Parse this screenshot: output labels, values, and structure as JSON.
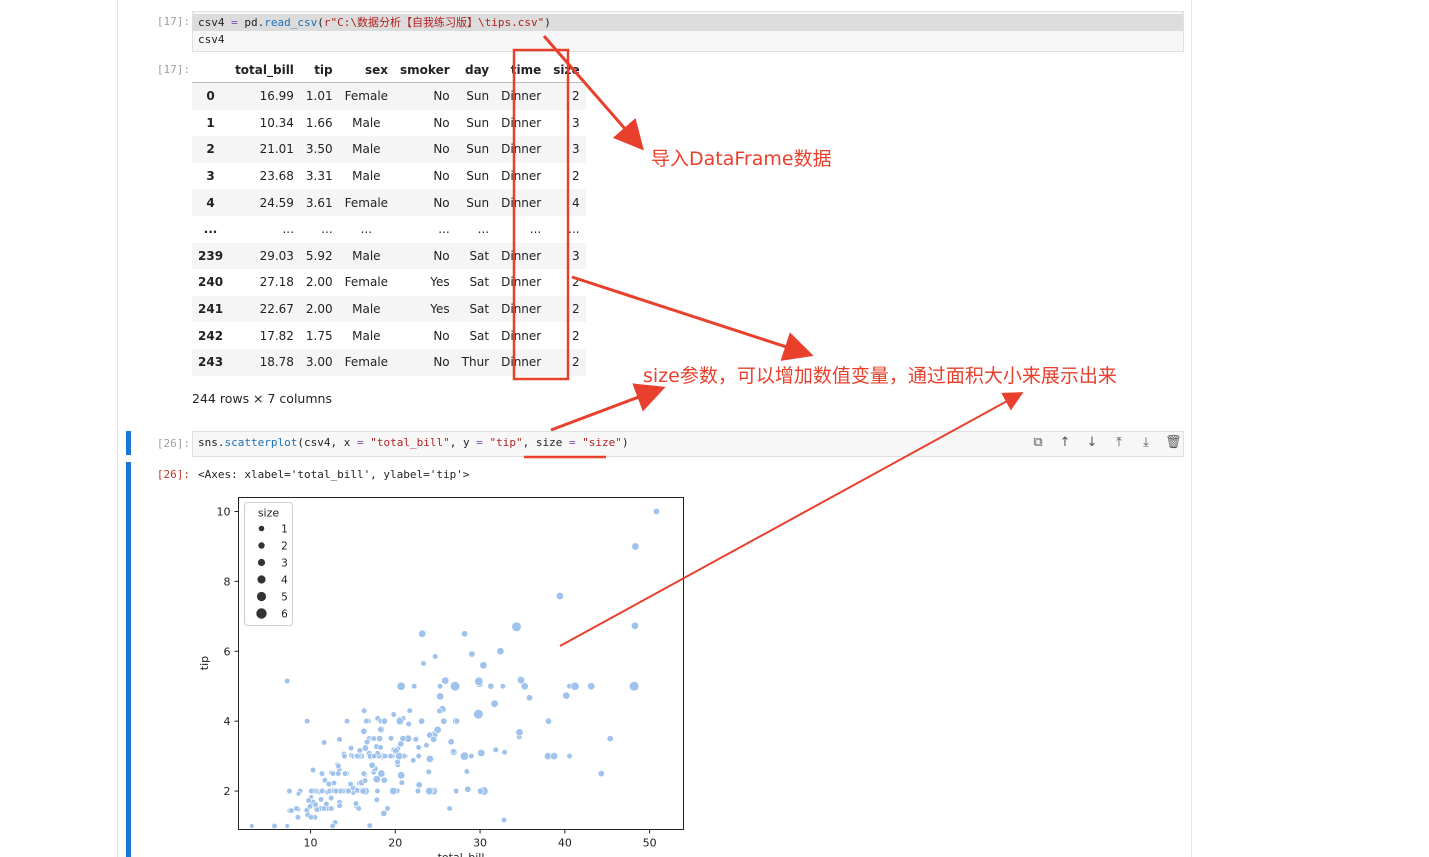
{
  "cell17": {
    "in_prompt": "[17]:",
    "out_prompt": "[17]:",
    "code_lines": [
      [
        [
          "csv4 ",
          "var"
        ],
        [
          "=",
          "op"
        ],
        [
          " pd.",
          "var"
        ],
        [
          "read_csv",
          "fn"
        ],
        [
          "(",
          "var"
        ],
        [
          "r\"C:\\数据分析【自我练习版】\\tips.csv\"",
          "str"
        ],
        [
          ")",
          "var"
        ]
      ],
      [
        [
          "csv4",
          "var"
        ]
      ]
    ]
  },
  "dataframe": {
    "columns": [
      "",
      "total_bill",
      "tip",
      "sex",
      "smoker",
      "day",
      "time",
      "size"
    ],
    "rows": [
      [
        "0",
        "16.99",
        "1.01",
        "Female",
        "No",
        "Sun",
        "Dinner",
        "2"
      ],
      [
        "1",
        "10.34",
        "1.66",
        "Male",
        "No",
        "Sun",
        "Dinner",
        "3"
      ],
      [
        "2",
        "21.01",
        "3.50",
        "Male",
        "No",
        "Sun",
        "Dinner",
        "3"
      ],
      [
        "3",
        "23.68",
        "3.31",
        "Male",
        "No",
        "Sun",
        "Dinner",
        "2"
      ],
      [
        "4",
        "24.59",
        "3.61",
        "Female",
        "No",
        "Sun",
        "Dinner",
        "4"
      ],
      [
        "...",
        "...",
        "...",
        "...",
        "...",
        "...",
        "...",
        "..."
      ],
      [
        "239",
        "29.03",
        "5.92",
        "Male",
        "No",
        "Sat",
        "Dinner",
        "3"
      ],
      [
        "240",
        "27.18",
        "2.00",
        "Female",
        "Yes",
        "Sat",
        "Dinner",
        "2"
      ],
      [
        "241",
        "22.67",
        "2.00",
        "Male",
        "Yes",
        "Sat",
        "Dinner",
        "2"
      ],
      [
        "242",
        "17.82",
        "1.75",
        "Male",
        "No",
        "Sat",
        "Dinner",
        "2"
      ],
      [
        "243",
        "18.78",
        "3.00",
        "Female",
        "No",
        "Thur",
        "Dinner",
        "2"
      ]
    ],
    "shape_text": "244 rows × 7 columns"
  },
  "cell26": {
    "in_prompt": "[26]:",
    "out_prompt": "[26]:",
    "code_tokens": [
      [
        "sns.",
        "var"
      ],
      [
        "scatterplot",
        "fn"
      ],
      [
        "(csv4, x ",
        "var"
      ],
      [
        "=",
        "op"
      ],
      [
        " ",
        "var"
      ],
      [
        "\"total_bill\"",
        "str"
      ],
      [
        ", y ",
        "var"
      ],
      [
        "=",
        "op"
      ],
      [
        " ",
        "var"
      ],
      [
        "\"tip\"",
        "str"
      ],
      [
        ", size ",
        "var"
      ],
      [
        "=",
        "op"
      ],
      [
        " ",
        "var"
      ],
      [
        "\"size\"",
        "str"
      ],
      [
        ")",
        "var"
      ]
    ],
    "output_text": "<Axes: xlabel='total_bill', ylabel='tip'>",
    "toolbar_icons": [
      "copy-icon",
      "arrow-up-icon",
      "arrow-down-icon",
      "insert-above-icon",
      "insert-below-icon",
      "trash-icon"
    ]
  },
  "annotations": {
    "import_label": "导入DataFrame数据",
    "size_label": "size参数，可以增加数值变量，通过面积大小来展示出来",
    "color": "#e8402d"
  },
  "chart_data": {
    "type": "scatter",
    "xlabel": "total_bill",
    "ylabel": "tip",
    "xticks": [
      10,
      20,
      30,
      40,
      50
    ],
    "yticks": [
      2,
      4,
      6,
      8,
      10
    ],
    "xlim": [
      1.5,
      54
    ],
    "ylim": [
      0.9,
      10.4
    ],
    "marker_color": "#9fc3ec",
    "legend": {
      "title": "size",
      "entries": [
        "1",
        "2",
        "3",
        "4",
        "5",
        "6"
      ],
      "placement": "top-left"
    },
    "points": [
      [
        50.81,
        10,
        3
      ],
      [
        48.33,
        9,
        4
      ],
      [
        39.42,
        7.58,
        4
      ],
      [
        48.27,
        6.73,
        4
      ],
      [
        34.3,
        6.7,
        6
      ],
      [
        23.33,
        6.5,
        2
      ],
      [
        28.2,
        6.5,
        2
      ],
      [
        7.25,
        5.15,
        2
      ],
      [
        20.69,
        5,
        5
      ],
      [
        24.71,
        5.85,
        2
      ],
      [
        32.4,
        6,
        4
      ],
      [
        29.03,
        5.92,
        3
      ],
      [
        30.4,
        5.6,
        4
      ],
      [
        25.89,
        5.16,
        4
      ],
      [
        43.11,
        5,
        4
      ],
      [
        48.17,
        5,
        6
      ],
      [
        40.55,
        5,
        2
      ],
      [
        44.3,
        2.5,
        3
      ],
      [
        34.81,
        5.2,
        4
      ],
      [
        30.14,
        3.09,
        4
      ],
      [
        27.18,
        2,
        2
      ],
      [
        26.88,
        3.12,
        4
      ],
      [
        16.99,
        1.01,
        2
      ],
      [
        10.34,
        1.66,
        3
      ],
      [
        21.01,
        3.5,
        3
      ],
      [
        23.68,
        3.31,
        2
      ],
      [
        24.59,
        3.61,
        4
      ],
      [
        25.29,
        4.71,
        4
      ],
      [
        8.77,
        2,
        2
      ],
      [
        26.88,
        3.12,
        4
      ],
      [
        15.04,
        1.96,
        2
      ],
      [
        14.78,
        3.23,
        2
      ],
      [
        10.27,
        1.71,
        2
      ],
      [
        35.26,
        5,
        4
      ],
      [
        15.42,
        1.57,
        2
      ],
      [
        18.43,
        3,
        4
      ],
      [
        14.83,
        3.02,
        2
      ],
      [
        21.58,
        3.92,
        2
      ],
      [
        10.33,
        1.67,
        3
      ],
      [
        16.29,
        3.71,
        3
      ],
      [
        16.97,
        3.5,
        3
      ],
      [
        20.65,
        3.35,
        3
      ],
      [
        17.92,
        4.08,
        2
      ],
      [
        20.29,
        2.75,
        2
      ],
      [
        15.77,
        2.23,
        2
      ],
      [
        39.42,
        7.58,
        4
      ],
      [
        19.82,
        3.18,
        2
      ],
      [
        17.81,
        2.34,
        4
      ],
      [
        13.37,
        2,
        2
      ],
      [
        12.69,
        2,
        2
      ],
      [
        21.7,
        4.3,
        2
      ],
      [
        19.65,
        3,
        2
      ],
      [
        9.55,
        1.45,
        2
      ],
      [
        18.35,
        2.5,
        4
      ],
      [
        15.06,
        3,
        2
      ],
      [
        20.69,
        2.45,
        4
      ],
      [
        17.78,
        3.27,
        2
      ],
      [
        24.06,
        3.6,
        3
      ],
      [
        16.31,
        2,
        3
      ],
      [
        16.93,
        3.07,
        3
      ],
      [
        18.69,
        2.31,
        3
      ],
      [
        31.27,
        5,
        3
      ],
      [
        16.04,
        2.24,
        3
      ],
      [
        17.46,
        2.54,
        2
      ],
      [
        13.94,
        3.06,
        2
      ],
      [
        9.68,
        1.32,
        2
      ],
      [
        30.4,
        5.6,
        4
      ],
      [
        18.29,
        3,
        2
      ],
      [
        22.23,
        5,
        2
      ],
      [
        32.4,
        6,
        4
      ],
      [
        28.55,
        2.05,
        3
      ],
      [
        18.04,
        3,
        2
      ],
      [
        12.54,
        2.5,
        2
      ],
      [
        10.29,
        2.6,
        2
      ],
      [
        34.81,
        5.2,
        4
      ],
      [
        9.94,
        1.56,
        2
      ],
      [
        25.56,
        4.34,
        4
      ],
      [
        19.49,
        3.51,
        2
      ],
      [
        38.01,
        3,
        4
      ],
      [
        26.41,
        1.5,
        2
      ],
      [
        11.24,
        1.76,
        2
      ],
      [
        48.27,
        6.73,
        4
      ],
      [
        20.29,
        3.21,
        2
      ],
      [
        13.81,
        2,
        2
      ],
      [
        11.02,
        1.98,
        2
      ],
      [
        18.29,
        3.76,
        4
      ],
      [
        17.59,
        2.64,
        3
      ],
      [
        20.08,
        3.15,
        3
      ],
      [
        16.45,
        2.47,
        2
      ],
      [
        3.07,
        1,
        1
      ],
      [
        20.23,
        2.01,
        2
      ],
      [
        15.01,
        2.09,
        2
      ],
      [
        12.02,
        1.97,
        2
      ],
      [
        17.07,
        3,
        3
      ],
      [
        26.86,
        3.14,
        2
      ],
      [
        25.28,
        5,
        2
      ],
      [
        14.73,
        2.2,
        2
      ],
      [
        10.51,
        1.25,
        2
      ],
      [
        17.92,
        3.08,
        2
      ],
      [
        27.2,
        4,
        4
      ],
      [
        22.76,
        3,
        2
      ],
      [
        17.29,
        2.71,
        2
      ],
      [
        19.44,
        3,
        2
      ],
      [
        16.66,
        3.4,
        2
      ],
      [
        10.07,
        1.83,
        1
      ],
      [
        32.68,
        5,
        2
      ],
      [
        15.98,
        2.03,
        2
      ],
      [
        34.83,
        5.17,
        4
      ],
      [
        13.03,
        2,
        2
      ],
      [
        18.28,
        4,
        2
      ],
      [
        24.71,
        5.85,
        2
      ],
      [
        21.16,
        3,
        2
      ],
      [
        28.97,
        3,
        2
      ],
      [
        22.49,
        3.5,
        2
      ],
      [
        5.75,
        1,
        2
      ],
      [
        16.32,
        4.3,
        2
      ],
      [
        22.75,
        3.25,
        2
      ],
      [
        40.17,
        4.73,
        4
      ],
      [
        27.28,
        4,
        2
      ],
      [
        12.03,
        1.5,
        2
      ],
      [
        21.01,
        3,
        2
      ],
      [
        12.46,
        1.5,
        2
      ],
      [
        11.35,
        2.5,
        2
      ],
      [
        15.38,
        3,
        2
      ],
      [
        44.3,
        2.5,
        3
      ],
      [
        22.42,
        3.48,
        2
      ],
      [
        20.92,
        4.08,
        2
      ],
      [
        15.36,
        1.64,
        2
      ],
      [
        20.49,
        4.06,
        2
      ],
      [
        25.21,
        4.29,
        2
      ],
      [
        18.24,
        3.76,
        2
      ],
      [
        14.31,
        4,
        2
      ],
      [
        14,
        3,
        2
      ],
      [
        7.25,
        1,
        1
      ],
      [
        38.07,
        4,
        3
      ],
      [
        23.95,
        2.55,
        2
      ],
      [
        25.71,
        4,
        3
      ],
      [
        17.31,
        3.5,
        2
      ],
      [
        29.93,
        5.07,
        4
      ],
      [
        10.65,
        1.5,
        2
      ],
      [
        12.43,
        1.8,
        2
      ],
      [
        24.08,
        2.92,
        4
      ],
      [
        11.69,
        2.31,
        2
      ],
      [
        13.42,
        1.68,
        2
      ],
      [
        14.26,
        2.5,
        2
      ],
      [
        15.95,
        2,
        2
      ],
      [
        12.48,
        2.52,
        2
      ],
      [
        29.8,
        4.2,
        6
      ],
      [
        8.52,
        1.48,
        2
      ],
      [
        14.52,
        2,
        2
      ],
      [
        11.38,
        2,
        2
      ],
      [
        22.82,
        2.18,
        3
      ],
      [
        19.08,
        1.5,
        2
      ],
      [
        20.27,
        2.83,
        2
      ],
      [
        11.17,
        1.5,
        2
      ],
      [
        12.26,
        2,
        2
      ],
      [
        18.26,
        3.25,
        2
      ],
      [
        8.51,
        1.25,
        2
      ],
      [
        10.33,
        2,
        2
      ],
      [
        14.15,
        2,
        2
      ],
      [
        16,
        2,
        2
      ],
      [
        13.16,
        2.75,
        2
      ],
      [
        17.47,
        3.5,
        2
      ],
      [
        34.3,
        6.7,
        6
      ],
      [
        41.19,
        5,
        5
      ],
      [
        27.05,
        5,
        6
      ],
      [
        16.43,
        2.3,
        2
      ],
      [
        8.35,
        1.5,
        2
      ],
      [
        18.64,
        1.36,
        3
      ],
      [
        11.87,
        1.63,
        2
      ],
      [
        9.78,
        1.73,
        2
      ],
      [
        7.51,
        2,
        2
      ],
      [
        14.07,
        2.5,
        2
      ],
      [
        13.13,
        2,
        2
      ],
      [
        17.26,
        2.74,
        3
      ],
      [
        24.55,
        2,
        4
      ],
      [
        19.77,
        2,
        4
      ],
      [
        29.85,
        5.14,
        5
      ],
      [
        48.17,
        5,
        6
      ],
      [
        25,
        3.75,
        4
      ],
      [
        13.39,
        2.61,
        2
      ],
      [
        16.49,
        2,
        4
      ],
      [
        21.5,
        3.5,
        4
      ],
      [
        12.66,
        2.5,
        2
      ],
      [
        16.21,
        2,
        3
      ],
      [
        13.81,
        2,
        2
      ],
      [
        17.51,
        3,
        2
      ],
      [
        24.52,
        3.48,
        3
      ],
      [
        20.76,
        2.24,
        2
      ],
      [
        31.71,
        4.5,
        4
      ],
      [
        10.59,
        1.61,
        2
      ],
      [
        10.63,
        2,
        2
      ],
      [
        50.81,
        10,
        3
      ],
      [
        15.81,
        3.16,
        2
      ],
      [
        7.25,
        5.15,
        2
      ],
      [
        31.85,
        3.18,
        2
      ],
      [
        16.82,
        4,
        2
      ],
      [
        32.9,
        3.11,
        2
      ],
      [
        17.89,
        2,
        2
      ],
      [
        14.48,
        2,
        2
      ],
      [
        9.6,
        4,
        2
      ],
      [
        34.63,
        3.55,
        2
      ],
      [
        34.65,
        3.68,
        4
      ],
      [
        23.33,
        5.65,
        2
      ],
      [
        45.35,
        3.5,
        3
      ],
      [
        23.17,
        6.5,
        4
      ],
      [
        40.55,
        3,
        2
      ],
      [
        20.69,
        5,
        5
      ],
      [
        20.9,
        3.5,
        3
      ],
      [
        30.46,
        2,
        5
      ],
      [
        18.15,
        3.5,
        3
      ],
      [
        23.1,
        4,
        3
      ],
      [
        15.69,
        1.5,
        2
      ],
      [
        19.81,
        4.19,
        2
      ],
      [
        28.44,
        2.56,
        2
      ],
      [
        15.48,
        2.02,
        2
      ],
      [
        16.58,
        4,
        2
      ],
      [
        7.56,
        1.44,
        2
      ],
      [
        10.34,
        2,
        2
      ],
      [
        43.11,
        5,
        4
      ],
      [
        13,
        2,
        2
      ],
      [
        13.51,
        2,
        2
      ],
      [
        18.71,
        4,
        3
      ],
      [
        12.74,
        2.01,
        2
      ],
      [
        13,
        2,
        2
      ],
      [
        16.4,
        2.5,
        2
      ],
      [
        20.53,
        4,
        4
      ],
      [
        16.47,
        3.23,
        3
      ],
      [
        26.59,
        3.41,
        3
      ],
      [
        38.73,
        3,
        4
      ],
      [
        24.27,
        2.03,
        2
      ],
      [
        12.76,
        2.23,
        2
      ],
      [
        30.06,
        2,
        3
      ],
      [
        25.89,
        5.16,
        4
      ],
      [
        48.33,
        9,
        4
      ],
      [
        13.27,
        2.5,
        2
      ],
      [
        28.17,
        6.5,
        3
      ],
      [
        12.9,
        1.1,
        2
      ],
      [
        28.15,
        3,
        5
      ],
      [
        11.59,
        1.5,
        2
      ],
      [
        7.74,
        1.44,
        2
      ],
      [
        30.14,
        3.09,
        4
      ],
      [
        12.16,
        2.2,
        2
      ],
      [
        13.42,
        3.48,
        2
      ],
      [
        8.58,
        1.92,
        1
      ],
      [
        15.98,
        3,
        3
      ],
      [
        13.42,
        1.58,
        2
      ],
      [
        16.27,
        2.5,
        2
      ],
      [
        10.09,
        2,
        2
      ],
      [
        20.45,
        3,
        4
      ],
      [
        13.28,
        2.72,
        2
      ],
      [
        22.12,
        2.88,
        2
      ],
      [
        24.01,
        2,
        4
      ],
      [
        15.69,
        3,
        3
      ],
      [
        11.61,
        3.39,
        2
      ],
      [
        10.77,
        1.47,
        2
      ],
      [
        15.53,
        3,
        2
      ],
      [
        10.07,
        1.25,
        2
      ],
      [
        12.6,
        1,
        2
      ],
      [
        32.83,
        1.17,
        2
      ],
      [
        35.83,
        4.67,
        3
      ],
      [
        29.03,
        5.92,
        3
      ],
      [
        27.18,
        2,
        2
      ],
      [
        22.67,
        2,
        2
      ],
      [
        17.82,
        1.75,
        2
      ],
      [
        18.78,
        3,
        2
      ]
    ]
  }
}
